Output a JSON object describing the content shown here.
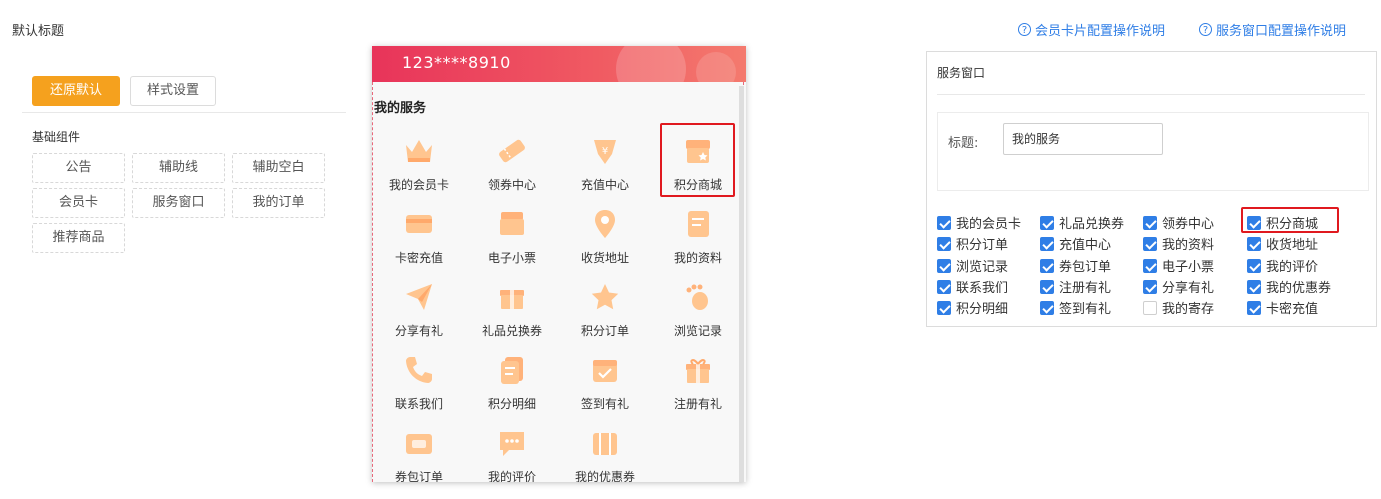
{
  "header": {
    "title": "默认标题",
    "help_links": [
      "会员卡片配置操作说明",
      "服务窗口配置操作说明"
    ],
    "help_icon": "question-circle-icon",
    "link_color": "#2f7ee6"
  },
  "left_panel": {
    "restore_button": "还原默认",
    "style_button": "样式设置",
    "section_label": "基础组件",
    "components": [
      "公告",
      "辅助线",
      "辅助空白",
      "会员卡",
      "服务窗口",
      "我的订单",
      "推荐商品"
    ],
    "accent": "#f5a11e"
  },
  "phone": {
    "number": "123****8910",
    "section_title": "我的服务",
    "services": [
      {
        "label": "我的会员卡",
        "icon": "crown-icon"
      },
      {
        "label": "领券中心",
        "icon": "ticket-icon"
      },
      {
        "label": "充值中心",
        "icon": "yen-bag-icon"
      },
      {
        "label": "积分商城",
        "icon": "store-star-icon"
      },
      {
        "label": "卡密充值",
        "icon": "card-icon"
      },
      {
        "label": "电子小票",
        "icon": "receipt-icon"
      },
      {
        "label": "收货地址",
        "icon": "location-pin-icon"
      },
      {
        "label": "我的资料",
        "icon": "document-icon"
      },
      {
        "label": "分享有礼",
        "icon": "paper-plane-icon"
      },
      {
        "label": "礼品兑换券",
        "icon": "gift-box-icon"
      },
      {
        "label": "积分订单",
        "icon": "star-icon"
      },
      {
        "label": "浏览记录",
        "icon": "footprint-icon"
      },
      {
        "label": "联系我们",
        "icon": "phone-icon"
      },
      {
        "label": "积分明细",
        "icon": "list-doc-icon"
      },
      {
        "label": "签到有礼",
        "icon": "calendar-check-icon"
      },
      {
        "label": "注册有礼",
        "icon": "gift-icon"
      },
      {
        "label": "券包订单",
        "icon": "coupon-bag-icon"
      },
      {
        "label": "我的评价",
        "icon": "chat-bubble-icon"
      },
      {
        "label": "我的优惠券",
        "icon": "coupon-icon"
      }
    ],
    "header_color": "#e8345a",
    "icon_color": "#ffb27a"
  },
  "right_panel": {
    "title": "服务窗口",
    "field_label": "标题:",
    "field_value": "我的服务",
    "checkboxes": [
      {
        "label": "我的会员卡",
        "checked": true
      },
      {
        "label": "礼品兑换券",
        "checked": true
      },
      {
        "label": "领券中心",
        "checked": true
      },
      {
        "label": "积分商城",
        "checked": true
      },
      {
        "label": "积分订单",
        "checked": true
      },
      {
        "label": "充值中心",
        "checked": true
      },
      {
        "label": "我的资料",
        "checked": true
      },
      {
        "label": "收货地址",
        "checked": true
      },
      {
        "label": "浏览记录",
        "checked": true
      },
      {
        "label": "券包订单",
        "checked": true
      },
      {
        "label": "电子小票",
        "checked": true
      },
      {
        "label": "我的评价",
        "checked": true
      },
      {
        "label": "联系我们",
        "checked": true
      },
      {
        "label": "注册有礼",
        "checked": true
      },
      {
        "label": "分享有礼",
        "checked": true
      },
      {
        "label": "我的优惠券",
        "checked": true
      },
      {
        "label": "积分明细",
        "checked": true
      },
      {
        "label": "签到有礼",
        "checked": true
      },
      {
        "label": "我的寄存",
        "checked": false
      },
      {
        "label": "卡密充值",
        "checked": true
      }
    ],
    "check_color": "#2f7ee6",
    "highlight_color": "#e0191f"
  }
}
